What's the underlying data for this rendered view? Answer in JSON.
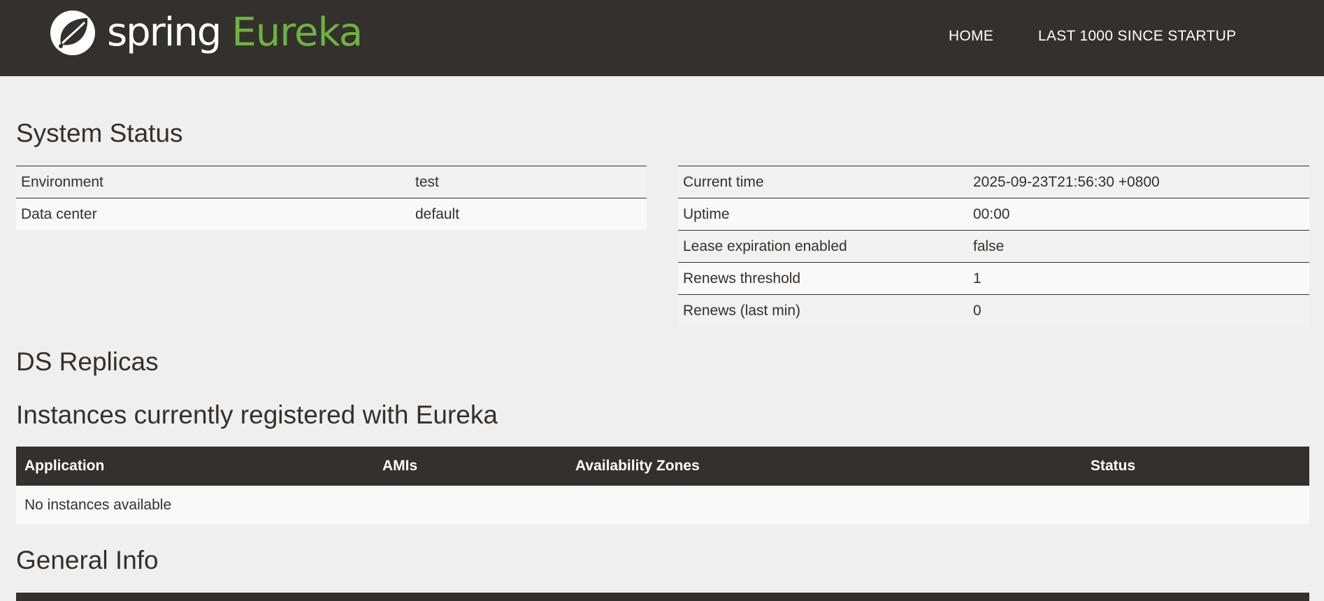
{
  "header": {
    "logo_spring": "spring",
    "logo_eureka": "Eureka",
    "nav": [
      {
        "label": "HOME"
      },
      {
        "label": "LAST 1000 SINCE STARTUP"
      }
    ]
  },
  "system_status": {
    "title": "System Status",
    "left": [
      {
        "key": "Environment",
        "value": "test"
      },
      {
        "key": "Data center",
        "value": "default"
      }
    ],
    "right": [
      {
        "key": "Current time",
        "value": "2025-09-23T21:56:30 +0800"
      },
      {
        "key": "Uptime",
        "value": "00:00"
      },
      {
        "key": "Lease expiration enabled",
        "value": "false"
      },
      {
        "key": "Renews threshold",
        "value": "1"
      },
      {
        "key": "Renews (last min)",
        "value": "0"
      }
    ]
  },
  "ds_replicas": {
    "title": "DS Replicas"
  },
  "instances": {
    "title": "Instances currently registered with Eureka",
    "columns": [
      "Application",
      "AMIs",
      "Availability Zones",
      "Status"
    ],
    "empty_message": "No instances available"
  },
  "general_info": {
    "title": "General Info"
  },
  "colors": {
    "header_bg": "#34302d",
    "brand_green": "#6db33f",
    "page_bg": "#efefef"
  }
}
